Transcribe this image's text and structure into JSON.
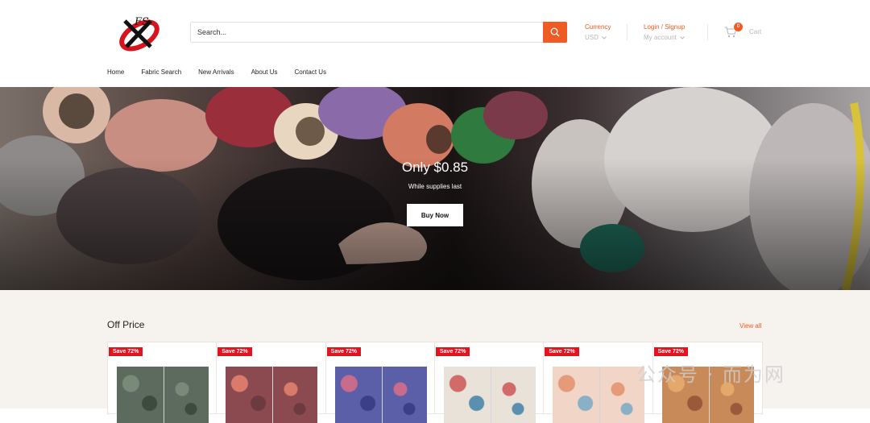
{
  "logo": {
    "text": "FS"
  },
  "search": {
    "placeholder": "Search..."
  },
  "currency": {
    "label": "Currency",
    "value": "USD"
  },
  "account": {
    "label": "Login / Signup",
    "value": "My account"
  },
  "cart": {
    "count": "0",
    "label": "Cart"
  },
  "nav": [
    "Home",
    "Fabric Search",
    "New Arrivals",
    "About Us",
    "Contact Us"
  ],
  "hero": {
    "title": "Only $0.85",
    "subtitle": "While supplies last",
    "button": "Buy Now"
  },
  "section": {
    "title": "Off Price",
    "view_all": "View all"
  },
  "products": [
    {
      "badge": "Save 72%",
      "colors": [
        "#5d6b5e",
        "#7a8a78",
        "#3d4a3e"
      ]
    },
    {
      "badge": "Save 72%",
      "colors": [
        "#8b4a4f",
        "#d97a6a",
        "#6d3a3f"
      ]
    },
    {
      "badge": "Save 72%",
      "colors": [
        "#5a5fa8",
        "#c96b8a",
        "#3a3f88"
      ]
    },
    {
      "badge": "Save 72%",
      "colors": [
        "#e8e2d8",
        "#d26a6a",
        "#5a8fb0"
      ]
    },
    {
      "badge": "Save 72%",
      "colors": [
        "#f1d6c8",
        "#e59a7a",
        "#8ab0c8"
      ]
    },
    {
      "badge": "Save 72%",
      "colors": [
        "#c98a5a",
        "#e4a86a",
        "#9a5a3a"
      ]
    }
  ],
  "watermark": "公众号 · 而为网",
  "colors": {
    "accent": "#f15a22",
    "badge": "#e3141f"
  }
}
